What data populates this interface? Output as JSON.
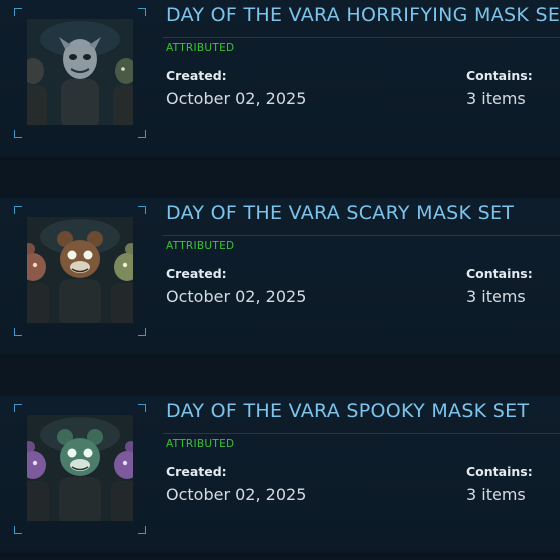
{
  "items": [
    {
      "title": "DAY OF THE VARA HORRIFYING MASK SET",
      "badge": "ATTRIBUTED",
      "created_label": "Created:",
      "created_value": "October 02, 2025",
      "contains_label": "Contains:",
      "contains_value": "3 items",
      "thumbnail_icon": "mask-set-thumbnail"
    },
    {
      "title": "DAY OF THE VARA SCARY MASK SET",
      "badge": "ATTRIBUTED",
      "created_label": "Created:",
      "created_value": "October 02, 2025",
      "contains_label": "Contains:",
      "contains_value": "3 items",
      "thumbnail_icon": "mask-set-thumbnail"
    },
    {
      "title": "DAY OF THE VARA SPOOKY MASK SET",
      "badge": "ATTRIBUTED",
      "created_label": "Created:",
      "created_value": "October 02, 2025",
      "contains_label": "Contains:",
      "contains_value": "3 items",
      "thumbnail_icon": "mask-set-thumbnail"
    }
  ],
  "colors": {
    "background": "#0b1620",
    "card": "#0e1d2b",
    "title": "#7cc4ec",
    "badge": "#3ec13a",
    "frame_corner": "#3f9ac7"
  }
}
